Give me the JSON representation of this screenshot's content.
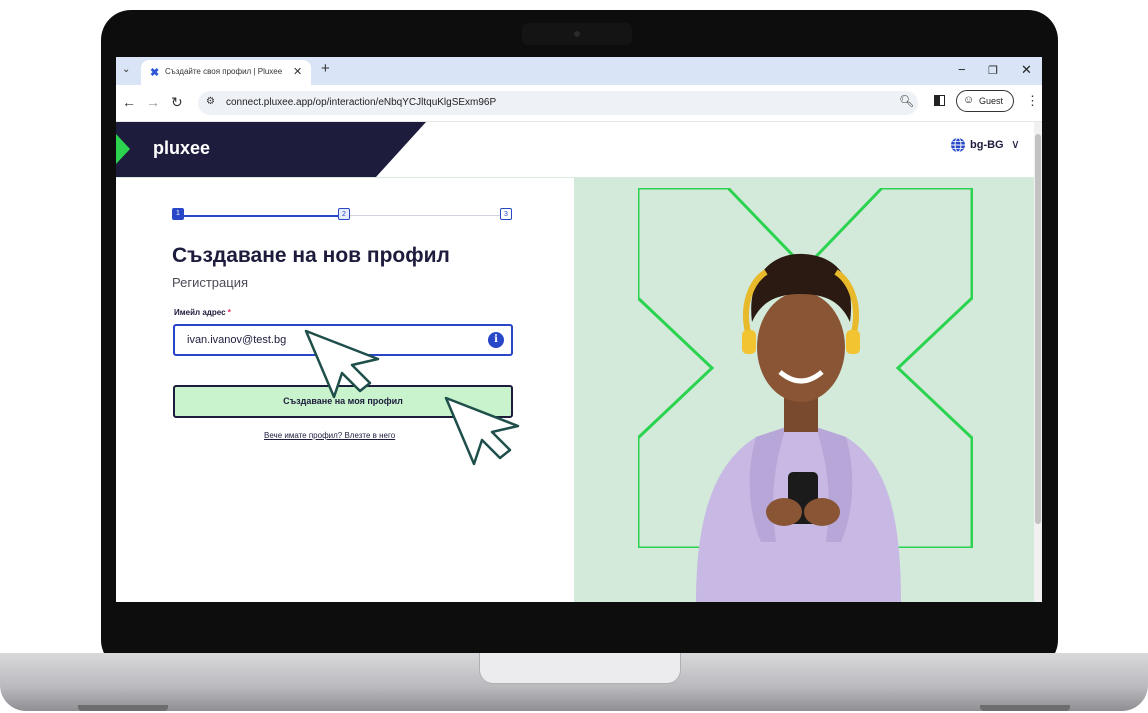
{
  "browser": {
    "tab_menu_icon": "chevron-down-icon",
    "tab_title": "Създайте своя профил | Pluxee",
    "new_tab": "+",
    "url": "connect.pluxee.app/op/interaction/eNbqYCJltquKlgSExm96P",
    "profile_label": "Guest",
    "window_controls": [
      "−",
      "❐",
      "✕"
    ]
  },
  "header": {
    "logo": "pluxee",
    "language": "bg-BG",
    "colors": {
      "brand_dark": "#1d1c3d",
      "brand_green": "#2bd34f"
    }
  },
  "stepper": {
    "steps": [
      "1",
      "2",
      "3"
    ],
    "current": 1
  },
  "form": {
    "title": "Създаване на нов профил",
    "subtitle": "Регистрация",
    "email_label": "Имейл адрес",
    "required_mark": "*",
    "email_value": "ivan.ivanov@test.bg",
    "info_icon": "i",
    "submit_label": "Създаване на моя профил",
    "login_link": "Вече имате профил? Влезте в него"
  },
  "colors": {
    "accent": "#2747c8",
    "button_bg": "#c9f3cc",
    "hero_bg": "#d3eadb"
  }
}
